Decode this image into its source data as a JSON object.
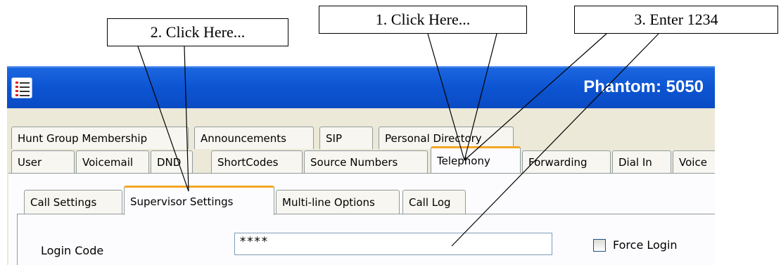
{
  "callouts": {
    "step1": "1. Click Here...",
    "step2": "2. Click Here...",
    "step3": "3. Enter 1234"
  },
  "window": {
    "title": "Phantom: 5050",
    "app_icon": "list-icon"
  },
  "tabs_row1": [
    "Hunt Group Membership",
    "Announcements",
    "SIP",
    "Personal Directory"
  ],
  "tabs_row2": [
    "User",
    "Voicemail",
    "DND",
    "ShortCodes",
    "Source Numbers",
    "Telephony",
    "Forwarding",
    "Dial In",
    "Voice"
  ],
  "active_tab": "Telephony",
  "subtabs": [
    "Call Settings",
    "Supervisor Settings",
    "Multi-line Options",
    "Call Log"
  ],
  "active_subtab": "Supervisor Settings",
  "form": {
    "login_code_label": "Login Code",
    "login_code_value": "****",
    "force_login_label": "Force Login",
    "force_login_checked": false
  },
  "colors": {
    "titlebar": "#0d54d2",
    "tab_accent": "#f5a623",
    "window_bg": "#ece9d8"
  }
}
